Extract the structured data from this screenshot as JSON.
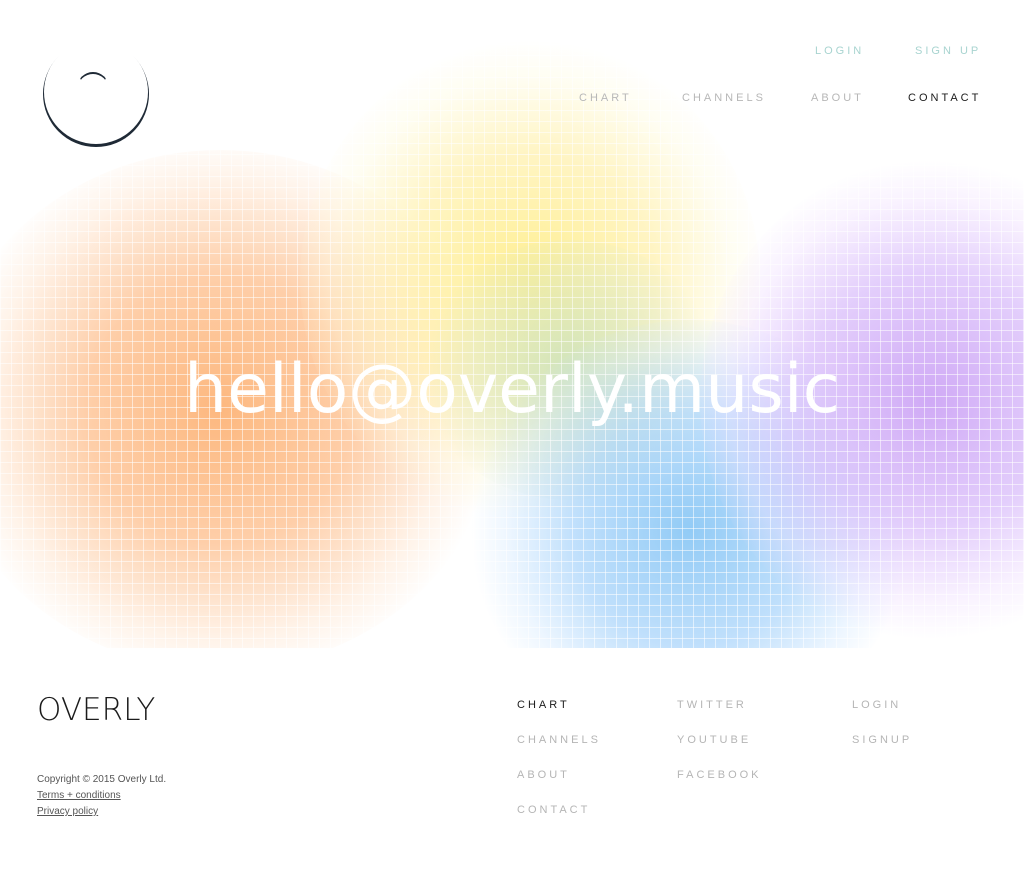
{
  "header": {
    "aux_links": [
      "LOGIN",
      "SIGN UP"
    ],
    "nav": [
      "CHART",
      "CHANNELS",
      "ABOUT",
      "CONTACT"
    ],
    "active_nav": "CONTACT"
  },
  "hero": {
    "email": "hello@overly.music"
  },
  "footer": {
    "brand": "OVERLY",
    "copyright": "Copyright © 2015 Overly Ltd.",
    "terms": "Terms + conditions",
    "privacy": "Privacy policy",
    "col1": [
      "CHART",
      "CHANNELS",
      "ABOUT",
      "CONTACT"
    ],
    "col2": [
      "TWITTER",
      "YOUTUBE",
      "FACEBOOK"
    ],
    "col3": [
      "LOGIN",
      "SIGNUP"
    ]
  },
  "colors": {
    "text_dark": "#1b1b1b",
    "nav_muted": "#b7b7b7",
    "aux_teal": "#a8d4d0"
  }
}
